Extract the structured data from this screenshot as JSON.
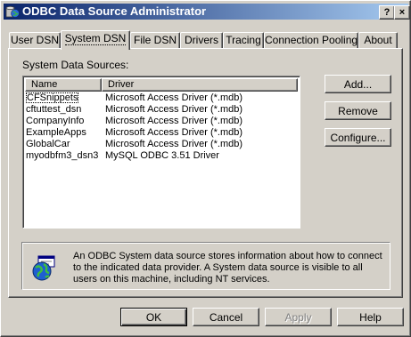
{
  "window": {
    "title": "ODBC Data Source Administrator",
    "help_button": "?",
    "close_button": "×"
  },
  "tabs": [
    {
      "label": "User DSN",
      "active": false
    },
    {
      "label": "System DSN",
      "active": true
    },
    {
      "label": "File DSN",
      "active": false
    },
    {
      "label": "Drivers",
      "active": false
    },
    {
      "label": "Tracing",
      "active": false
    },
    {
      "label": "Connection Pooling",
      "active": false
    },
    {
      "label": "About",
      "active": false
    }
  ],
  "system_dsn": {
    "section_label": "System Data Sources:",
    "columns": {
      "name": "Name",
      "driver": "Driver"
    },
    "rows": [
      {
        "name": "CFSnippets",
        "driver": "Microsoft Access Driver (*.mdb)"
      },
      {
        "name": "cftuttest_dsn",
        "driver": "Microsoft Access Driver (*.mdb)"
      },
      {
        "name": "CompanyInfo",
        "driver": "Microsoft Access Driver (*.mdb)"
      },
      {
        "name": "ExampleApps",
        "driver": "Microsoft Access Driver (*.mdb)"
      },
      {
        "name": "GlobalCar",
        "driver": "Microsoft Access Driver (*.mdb)"
      },
      {
        "name": "myodbfm3_dsn3",
        "driver": "MySQL ODBC 3.51 Driver"
      }
    ],
    "selected_row": "CFSnippets",
    "add_label": "Add...",
    "remove_label": "Remove",
    "configure_label": "Configure...",
    "info_text": "An ODBC System data source stores information about how to connect to the indicated data provider.  A System data source is visible to all users on this machine, including NT services."
  },
  "footer": {
    "ok_label": "OK",
    "cancel_label": "Cancel",
    "apply_label": "Apply",
    "help_label": "Help"
  }
}
